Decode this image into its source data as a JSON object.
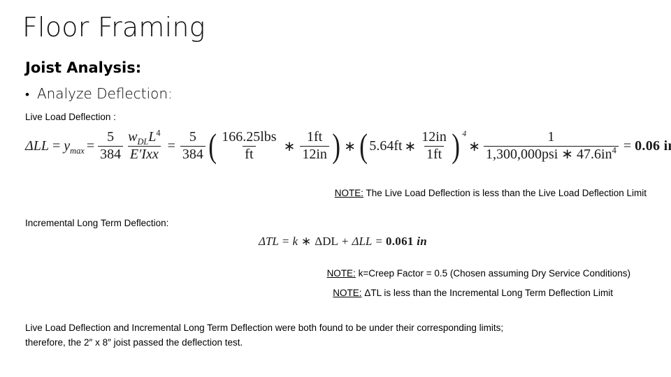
{
  "slide": {
    "title": "Floor Framing",
    "heading": "Joist Analysis:",
    "bullet": {
      "marker": "•",
      "text": "Analyze Deflection:"
    },
    "live_load_label": "Live Load Deflection :",
    "incremental_label": "Incremental Long Term Deflection:",
    "notes": [
      {
        "tag": "NOTE:",
        "text": " The Live Load Deflection is less than the Live Load Deflection Limit"
      },
      {
        "tag": "NOTE:",
        "text": " k=Creep Factor = 0.5 (Chosen assuming Dry Service Conditions)"
      },
      {
        "tag": "NOTE:",
        "text": " ΔTL is less than the Incremental Long Term Deflection Limit"
      }
    ],
    "conclusion": {
      "line1": "Live Load Deflection and Incremental Long Term Deflection were both found to be under their corresponding limits;",
      "line2": "therefore, the 2″ x 8″ joist passed the deflection test."
    }
  },
  "equations": {
    "live_load": {
      "lhs": "ΔLL",
      "eq1": "=",
      "ymax_base": "y",
      "ymax_sub": "max",
      "eq2": "=",
      "coef1_num": "5",
      "coef1_den": "384",
      "term_num_w": "w",
      "term_num_w_sub": "DL",
      "term_num_L": "L",
      "term_num_L_sup": "4",
      "term_den": "E′Ixx",
      "eq3": "=",
      "coef2_num": "5",
      "coef2_den": "384",
      "g1_f1_num": "166.25lbs",
      "g1_f1_den": "ft",
      "g1_op": "∗",
      "g1_f2_num": "1ft",
      "g1_f2_den": "12in",
      "op_mid1": "∗",
      "g2_lead": "5.64ft",
      "g2_op": "∗",
      "g2_f_num": "12in",
      "g2_f_den": "1ft",
      "g2_sup": "4",
      "op_mid2": "∗",
      "g3_num": "1",
      "g3_den": "1,300,000psi ∗ 47.6in",
      "g3_den_sup": "4",
      "eq_final": "=",
      "result_value": "0.06",
      "result_unit": "in"
    },
    "total_load": {
      "lhs": "ΔTL",
      "eq1": "=",
      "k": "k",
      "op1": "∗",
      "dl": "ΔDL",
      "op2": "+",
      "ll": "ΔLL",
      "eq2": "=",
      "result_value": "0.061",
      "result_unit": "in"
    }
  }
}
